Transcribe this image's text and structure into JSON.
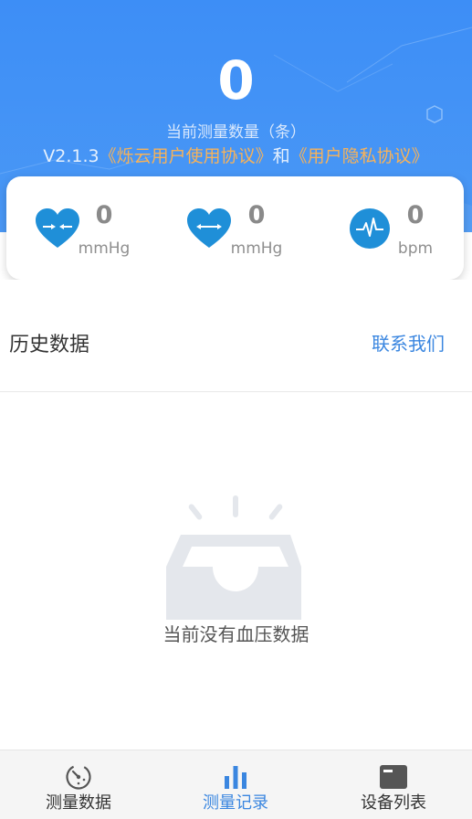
{
  "header": {
    "count": "0",
    "count_label": "当前测量数量（条）",
    "version": "V2.1.3",
    "user_agreement": "《烁云用户使用协议》",
    "and_text": "和",
    "privacy_agreement": "《用户隐私协议》"
  },
  "stats": [
    {
      "icon": "heart-compress-icon",
      "value": "0",
      "unit": "mmHg"
    },
    {
      "icon": "heart-expand-icon",
      "value": "0",
      "unit": "mmHg"
    },
    {
      "icon": "heartbeat-pulse-icon",
      "value": "0",
      "unit": "bpm"
    }
  ],
  "history": {
    "title": "历史数据",
    "contact": "联系我们",
    "empty_icon": "empty-inbox-icon",
    "empty_text": "当前没有血压数据"
  },
  "tabs": [
    {
      "label": "测量数据",
      "icon": "gauge-icon",
      "active": false
    },
    {
      "label": "测量记录",
      "icon": "bar-chart-icon",
      "active": true
    },
    {
      "label": "设备列表",
      "icon": "device-list-icon",
      "active": false
    }
  ],
  "colors": {
    "primary_blue": "#3d8ef6",
    "accent_orange": "#f6b25a",
    "icon_blue": "#1f8fd8",
    "link_blue": "#3a86e0"
  }
}
